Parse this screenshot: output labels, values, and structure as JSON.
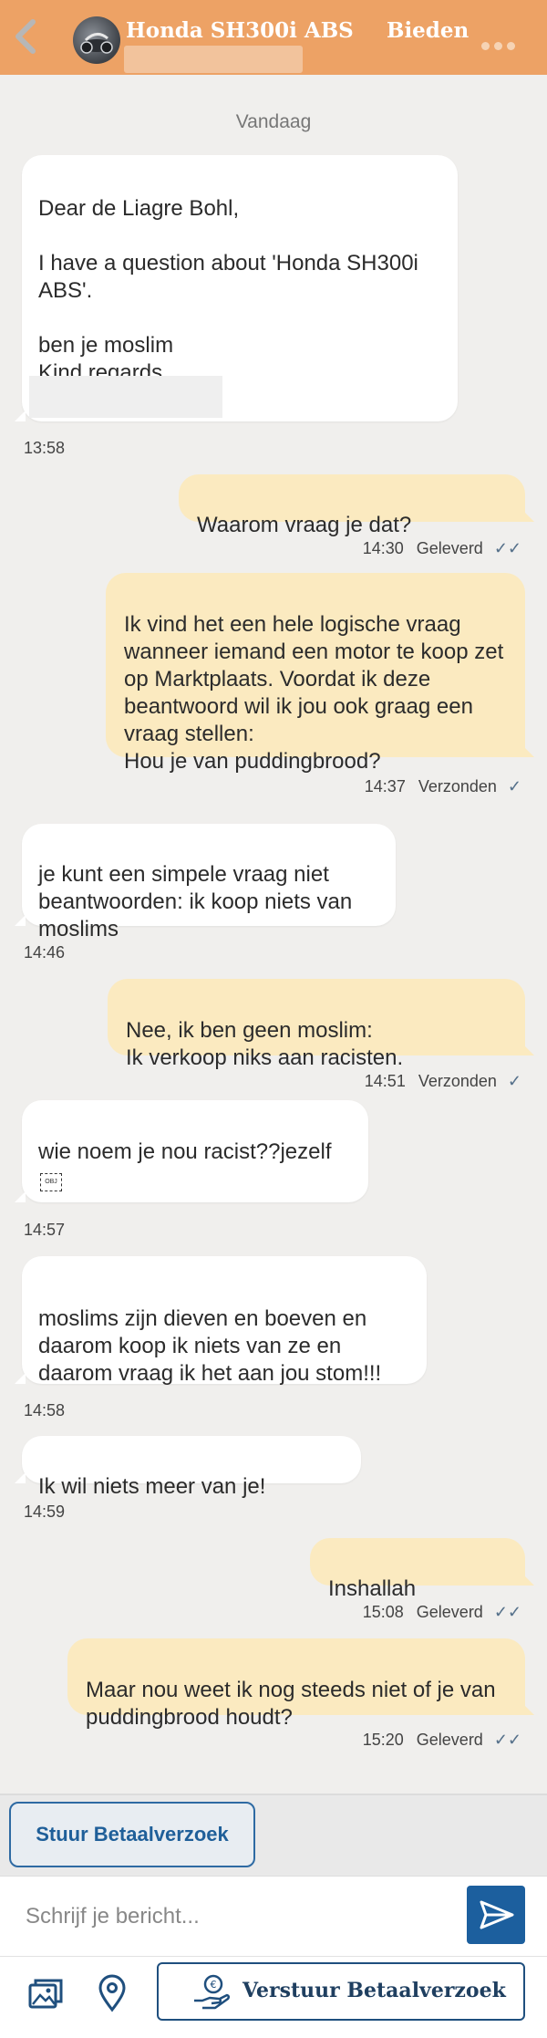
{
  "header": {
    "title": "Honda SH300i ABS",
    "bid_label": "Bieden"
  },
  "day_label": "Vandaag",
  "messages": [
    {
      "dir": "in",
      "text": "Dear de Liagre Bohl,\n\nI have a question about 'Honda SH300i ABS'.\n\nben je moslim\nKind regards,",
      "time": "13:58"
    },
    {
      "dir": "out",
      "text": "Waarom vraag je dat?",
      "time": "14:30",
      "status": "Geleverd",
      "check": "✓✓"
    },
    {
      "dir": "out",
      "text": "Ik vind het een hele logische vraag wanneer iemand een motor te koop zet op Marktplaats. Voordat ik deze beantwoord wil ik jou ook graag een vraag stellen:\nHou je van puddingbrood?",
      "time": "14:37",
      "status": "Verzonden",
      "check": "✓"
    },
    {
      "dir": "in",
      "text": "je kunt een simpele vraag niet beantwoorden: ik koop niets van moslims",
      "time": "14:46"
    },
    {
      "dir": "out",
      "text": "Nee, ik ben geen moslim:\nIk verkoop niks aan racisten.",
      "time": "14:51",
      "status": "Verzonden",
      "check": "✓"
    },
    {
      "dir": "in",
      "text": "wie noem je nou racist??jezelf",
      "time": "14:57",
      "obj_label": "OBJ"
    },
    {
      "dir": "in",
      "text": "moslims zijn dieven en boeven en daarom koop ik niets van ze en daarom vraag ik het aan jou stom!!!",
      "time": "14:58"
    },
    {
      "dir": "in",
      "text": "Ik wil niets meer van je!",
      "time": "14:59"
    },
    {
      "dir": "out",
      "text": "Inshallah",
      "time": "15:08",
      "status": "Geleverd",
      "check": "✓✓"
    },
    {
      "dir": "out",
      "text": "Maar nou weet ik nog steeds niet of je van puddingbrood houdt?",
      "time": "15:20",
      "status": "Geleverd",
      "check": "✓✓"
    }
  ],
  "bottom": {
    "pay_request_label": "Stuur Betaalverzoek",
    "input_placeholder": "Schrijf je bericht...",
    "send_pay_label": "Verstuur Betaalverzoek"
  },
  "colors": {
    "header": "#eda265",
    "outgoing_bubble": "#fbeac0",
    "incoming_bubble": "#ffffff",
    "accent_blue": "#1c5f9e"
  },
  "icons": [
    "back-icon",
    "more-icon",
    "send-icon",
    "gallery-icon",
    "location-icon",
    "hand-coin-icon"
  ]
}
